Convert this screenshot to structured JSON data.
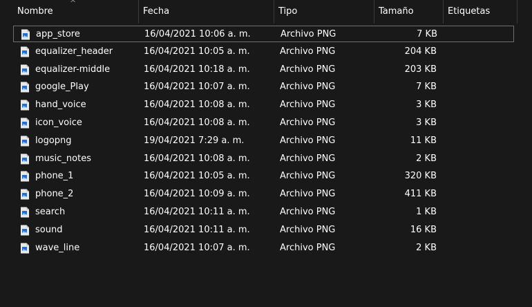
{
  "columns": {
    "name": "Nombre",
    "date": "Fecha",
    "type": "Tipo",
    "size": "Tamaño",
    "tags": "Etiquetas"
  },
  "sort": {
    "column": "Nombre",
    "icon": "sort-up-icon",
    "symbol": "^"
  },
  "files": [
    {
      "name": "app_store",
      "date": "16/04/2021 10:06 a. m.",
      "type": "Archivo PNG",
      "size": "7 KB",
      "focused": true
    },
    {
      "name": "equalizer_header",
      "date": "16/04/2021 10:05 a. m.",
      "type": "Archivo PNG",
      "size": "204 KB"
    },
    {
      "name": "equalizer-middle",
      "date": "16/04/2021 10:18 a. m.",
      "type": "Archivo PNG",
      "size": "203 KB"
    },
    {
      "name": "google_Play",
      "date": "16/04/2021 10:07 a. m.",
      "type": "Archivo PNG",
      "size": "7 KB"
    },
    {
      "name": "hand_voice",
      "date": "16/04/2021 10:08 a. m.",
      "type": "Archivo PNG",
      "size": "3 KB"
    },
    {
      "name": "icon_voice",
      "date": "16/04/2021 10:08 a. m.",
      "type": "Archivo PNG",
      "size": "3 KB"
    },
    {
      "name": "logopng",
      "date": "19/04/2021 7:29 a. m.",
      "type": "Archivo PNG",
      "size": "11 KB"
    },
    {
      "name": "music_notes",
      "date": "16/04/2021 10:08 a. m.",
      "type": "Archivo PNG",
      "size": "2 KB"
    },
    {
      "name": "phone_1",
      "date": "16/04/2021 10:05 a. m.",
      "type": "Archivo PNG",
      "size": "320 KB"
    },
    {
      "name": "phone_2",
      "date": "16/04/2021 10:09 a. m.",
      "type": "Archivo PNG",
      "size": "411 KB"
    },
    {
      "name": "search",
      "date": "16/04/2021 10:11 a. m.",
      "type": "Archivo PNG",
      "size": "1 KB"
    },
    {
      "name": "sound",
      "date": "16/04/2021 10:11 a. m.",
      "type": "Archivo PNG",
      "size": "16 KB"
    },
    {
      "name": "wave_line",
      "date": "16/04/2021 10:07 a. m.",
      "type": "Archivo PNG",
      "size": "2 KB"
    }
  ],
  "file_icon": "png-image-file-icon",
  "colors": {
    "background": "#191919",
    "text": "#ffffff",
    "icon_page": "#e8e8e8",
    "icon_accent": "#1f6fd6",
    "focus_border": "#6f6f6f"
  }
}
